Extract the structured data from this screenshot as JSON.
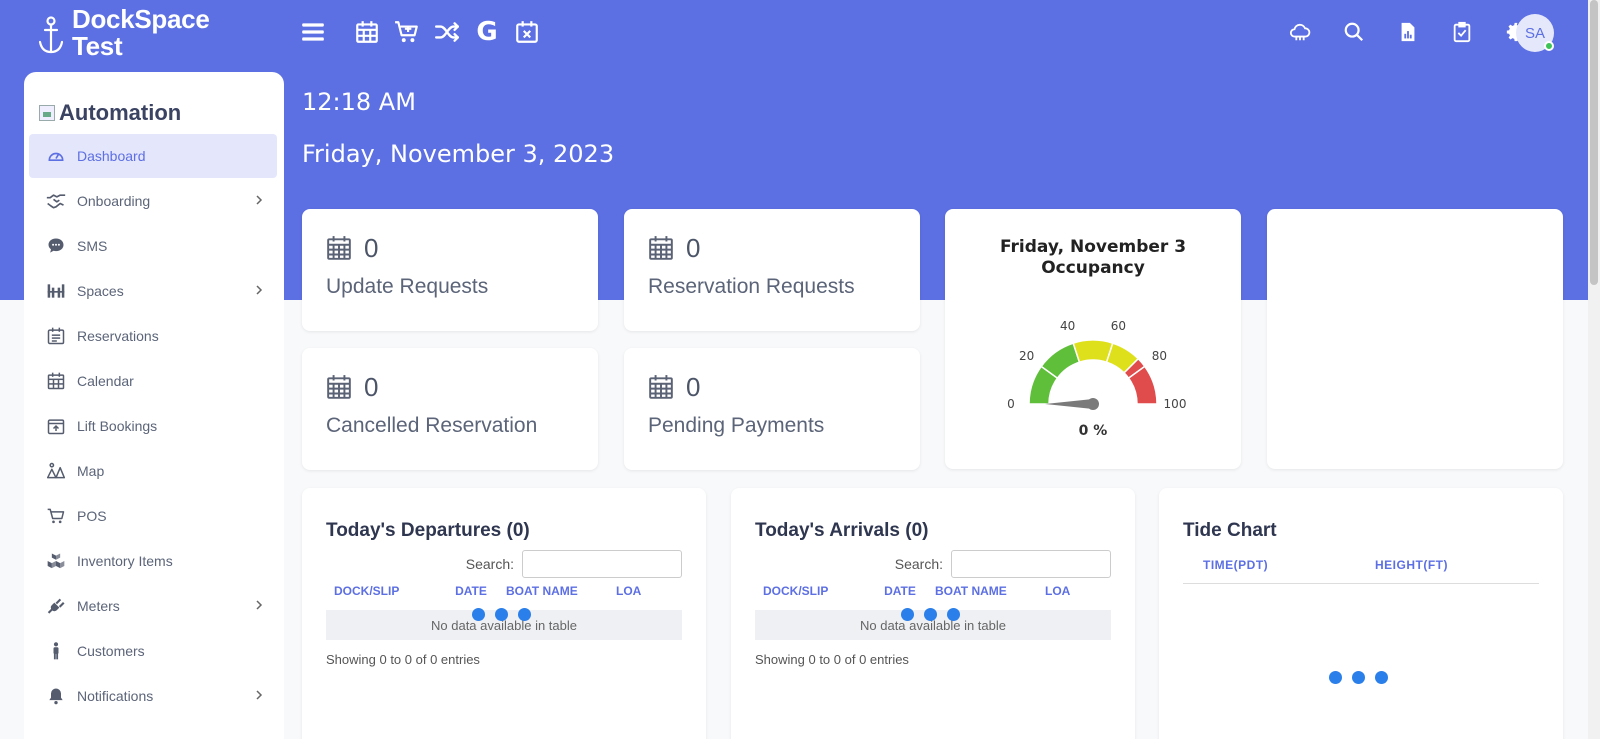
{
  "brand": {
    "name_line1": "DockSpace",
    "name_line2": "Test"
  },
  "sidebar": {
    "org_name": "Automation",
    "items": [
      {
        "label": "Dashboard",
        "icon": "dashboard-gauge-icon",
        "active": true,
        "expandable": false
      },
      {
        "label": "Onboarding",
        "icon": "handshake-icon",
        "expandable": true
      },
      {
        "label": "SMS",
        "icon": "chat-bubble-icon",
        "expandable": false
      },
      {
        "label": "Spaces",
        "icon": "dock-spaces-icon",
        "expandable": true
      },
      {
        "label": "Reservations",
        "icon": "calendar-list-icon",
        "expandable": false
      },
      {
        "label": "Calendar",
        "icon": "calendar-icon",
        "expandable": false
      },
      {
        "label": "Lift Bookings",
        "icon": "lift-box-icon",
        "expandable": false
      },
      {
        "label": "Map",
        "icon": "map-icon",
        "expandable": false
      },
      {
        "label": "POS",
        "icon": "cart-icon",
        "expandable": false
      },
      {
        "label": "Inventory Items",
        "icon": "boxes-icon",
        "expandable": false
      },
      {
        "label": "Meters",
        "icon": "plug-icon",
        "expandable": true
      },
      {
        "label": "Customers",
        "icon": "person-icon",
        "expandable": false
      },
      {
        "label": "Notifications",
        "icon": "bell-icon",
        "expandable": true
      }
    ]
  },
  "header": {
    "time": "12:18 AM",
    "date": "Friday, November 3, 2023",
    "avatar_initials": "SA",
    "g_letter": "G"
  },
  "stats": [
    {
      "value": "0",
      "label": "Update Requests"
    },
    {
      "value": "0",
      "label": "Reservation Requests"
    },
    {
      "value": "0",
      "label": "Cancelled Reservation"
    },
    {
      "value": "0",
      "label": "Pending Payments"
    }
  ],
  "occupancy": {
    "title_line1": "Friday, November 3",
    "title_line2": "Occupancy",
    "value": 0,
    "value_text": "0 %",
    "ticks": [
      "0",
      "20",
      "40",
      "60",
      "80",
      "100"
    ],
    "colors": {
      "low": "#5fbf3a",
      "mid": "#dfe01c",
      "high": "#e04b4b"
    }
  },
  "departures": {
    "title": "Today's Departures (0)",
    "search_label": "Search:",
    "columns": [
      "DOCK/SLIP",
      "DATE",
      "BOAT NAME",
      "LOA"
    ],
    "empty_text": "No data available in table",
    "entries_text": "Showing 0 to 0 of 0 entries"
  },
  "arrivals": {
    "title": "Today's Arrivals (0)",
    "search_label": "Search:",
    "columns": [
      "DOCK/SLIP",
      "DATE",
      "BOAT NAME",
      "LOA"
    ],
    "empty_text": "No data available in table",
    "entries_text": "Showing 0 to 0 of 0 entries"
  },
  "tide": {
    "title": "Tide Chart",
    "col_time": "TIME(PDT)",
    "col_height": "HEIGHT(FT)"
  },
  "colors": {
    "accent": "#5c6fe3",
    "loader": "#2b7fea"
  }
}
